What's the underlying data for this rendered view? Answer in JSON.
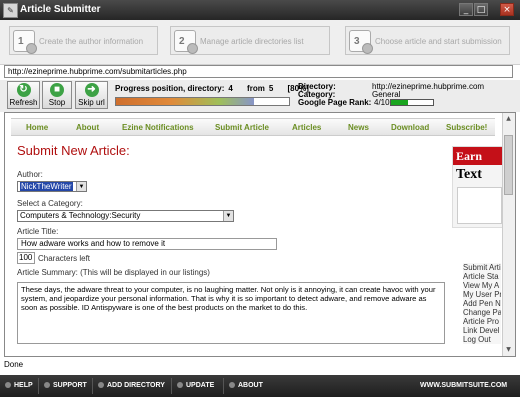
{
  "window": {
    "title": "Article Submitter",
    "minimize": "_",
    "maximize": "□",
    "close": "×"
  },
  "steps": [
    {
      "num": "1",
      "label": "Create the author information"
    },
    {
      "num": "2",
      "label": "Manage article directories list"
    },
    {
      "num": "3",
      "label": "Choose article and start submission"
    }
  ],
  "url": "http://ezineprime.hubprime.com/submitarticles.php",
  "toolbar": {
    "refresh": "Refresh",
    "stop": "Stop",
    "skip": "Skip url"
  },
  "progress": {
    "label": "Progress position, directory:",
    "current": "4",
    "from_label": "from",
    "total": "5",
    "percent_text": "[80%]",
    "percent": 80
  },
  "directory": {
    "directory_label": "Directory:",
    "directory_value": "http://ezineprime.hubprime.com",
    "category_label": "Category:",
    "category_value": "General",
    "rank_label": "Google Page Rank:",
    "rank_value": "4/10",
    "rank_fraction": 0.4
  },
  "nav": [
    "Home",
    "About",
    "Ezine Notifications",
    "Submit Article",
    "Articles",
    "News",
    "Download",
    "Subscribe!"
  ],
  "form": {
    "title": "Submit New Article:",
    "author_label": "Author:",
    "author_value": "NickTheWriter",
    "category_label": "Select a Category:",
    "category_value": "Computers & Technology:Security",
    "article_title_label": "Article Title:",
    "article_title_value": "How adware works and how to remove it",
    "chars_value": "100",
    "chars_label": "Characters left",
    "summary_label": "Article Summary: (This will be displayed in our listings)",
    "summary_value": "These days, the adware threat to your computer, is no laughing matter. Not only is it annoying, it can create havoc with your system, and jeopardize your personal information. That is why it is so important to detect adware, and remove adware as soon as possible. ID Antispyware is one of the best products on the market to do this."
  },
  "ad": {
    "line1": "Earn",
    "line2": "Text"
  },
  "side_links": [
    "Submit Article",
    "Article Sta",
    "View My A",
    "My User Pr",
    "Add Pen N",
    "Change Pa",
    "Article Pro",
    "Link Devel",
    "Log Out"
  ],
  "status": "Done",
  "footer": {
    "help": "HELP",
    "support": "SUPPORT",
    "add_directory": "ADD DIRECTORY",
    "update": "UPDATE",
    "about": "ABOUT",
    "site": "WWW.SUBMITSUITE.COM"
  }
}
